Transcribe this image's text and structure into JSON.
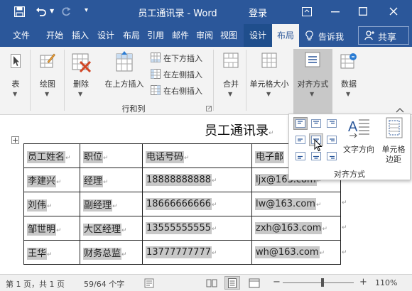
{
  "titlebar": {
    "doc_title": "员工通讯录 - Word",
    "login": "登录",
    "qa_sep": "|"
  },
  "tabs": [
    "文件",
    "开始",
    "插入",
    "设计",
    "布局",
    "引用",
    "邮件",
    "审阅",
    "视图",
    "设计",
    "布局"
  ],
  "tellme": "告诉我",
  "share": "共享",
  "ribbon": {
    "table": "表",
    "draw": "绘图",
    "delete": "删除",
    "insert_above": "在上方插入",
    "insert_below": "在下方插入",
    "insert_left": "在左侧插入",
    "insert_right": "在右侧插入",
    "rows_cols_group": "行和列",
    "merge": "合并",
    "cell_size": "单元格大小",
    "alignment": "对齐方式",
    "data": "数据"
  },
  "flyout": {
    "text_direction": "文字方向",
    "cell_margin_1": "单元格",
    "cell_margin_2": "边距",
    "group_label": "对齐方式"
  },
  "document": {
    "title": "员工通讯录",
    "headers": [
      "员工姓名",
      "职位",
      "电话号码",
      "电子邮"
    ],
    "rows": [
      [
        "李建兴",
        "经理",
        "18888888888",
        "ljx@163.com"
      ],
      [
        "刘伟",
        "副经理",
        "18666666666",
        "lw@163.com"
      ],
      [
        "邹世明",
        "大区经理",
        "13555555555",
        "zxh@163.com"
      ],
      [
        "王华",
        "财务总监",
        "13777777777",
        "wh@163.com"
      ]
    ]
  },
  "status": {
    "page": "第 1 页，共 1 页",
    "words": "59/64 个字",
    "zoom": "110%",
    "minus": "−",
    "plus": "+"
  },
  "colors": {
    "accent": "#2b579a",
    "context_tab": "#1f4e8c",
    "selection": "#c8c8c8"
  }
}
